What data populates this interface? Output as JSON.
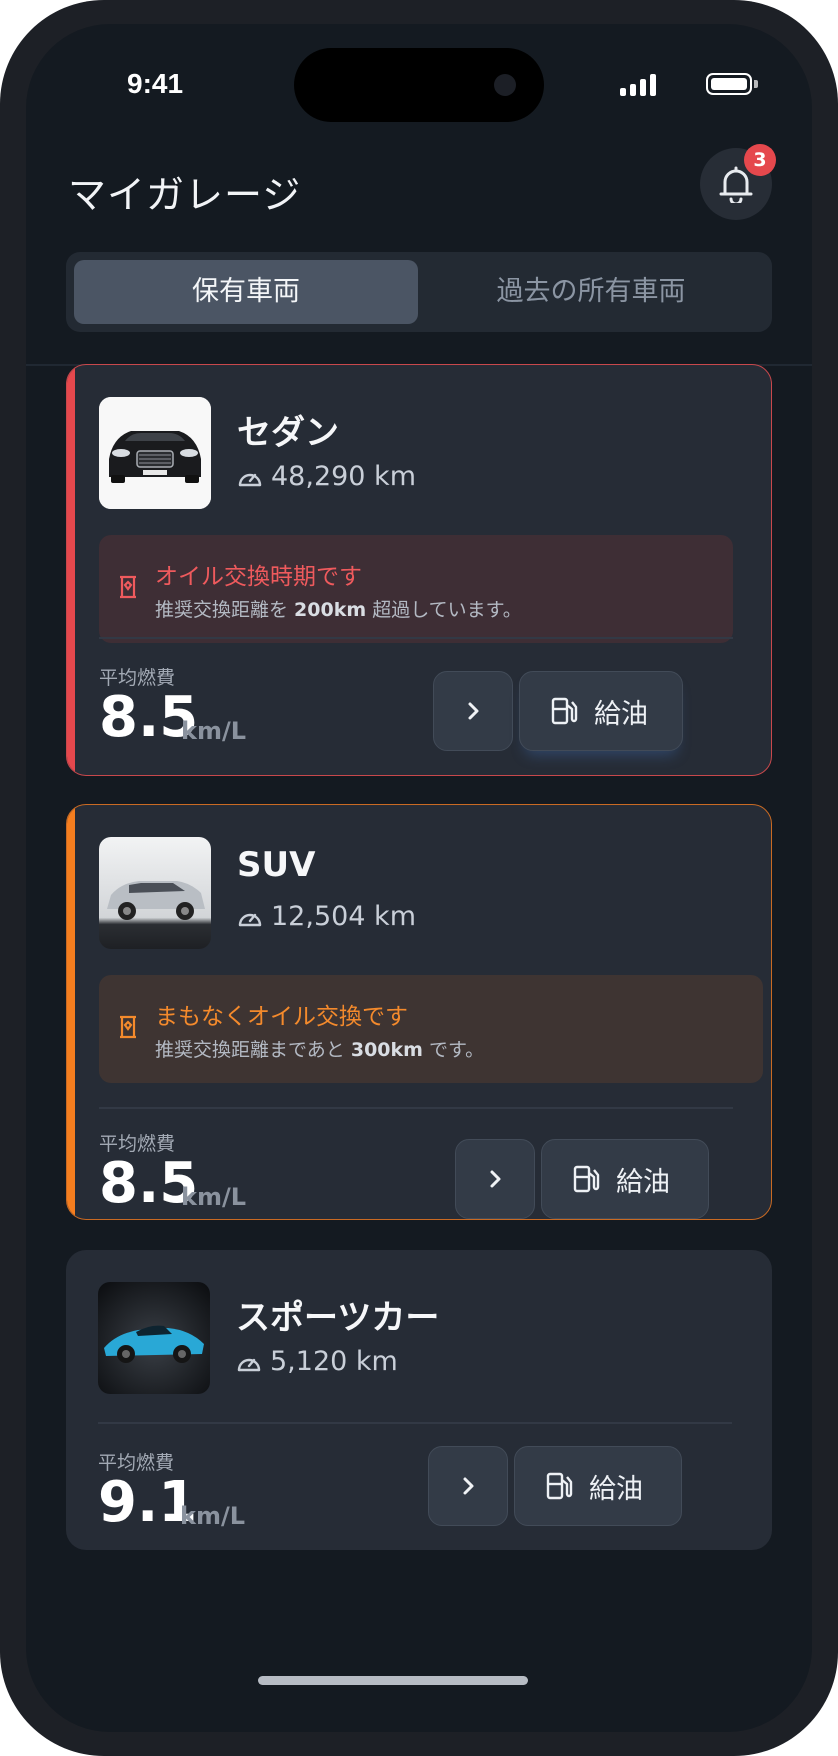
{
  "status": {
    "time": "9:41"
  },
  "header": {
    "title": "マイガレージ",
    "notification_count": "3"
  },
  "tabs": [
    {
      "label": "保有車両",
      "active": true
    },
    {
      "label": "過去の所有車両",
      "active": false
    }
  ],
  "vehicles": [
    {
      "name": "セダン",
      "mileage": "48,290 km",
      "alert": {
        "level": "danger",
        "title": "オイル交換時期です",
        "body_prefix": "推奨交換距離を ",
        "body_value": "200km",
        "body_suffix": " 超過しています。"
      },
      "efficiency_label": "平均燃費",
      "efficiency_value": "8.5",
      "efficiency_unit": "km/L",
      "refuel_label": "給油"
    },
    {
      "name": "SUV",
      "mileage": "12,504 km",
      "alert": {
        "level": "warning",
        "title": "まもなくオイル交換です",
        "body_prefix": "推奨交換距離まであと ",
        "body_value": "300km",
        "body_suffix": " です。"
      },
      "efficiency_label": "平均燃費",
      "efficiency_value": "8.5",
      "efficiency_unit": "km/L",
      "refuel_label": "給油"
    },
    {
      "name": "スポーツカー",
      "mileage": "5,120 km",
      "efficiency_label": "平均燃費",
      "efficiency_value": "9.1",
      "efficiency_unit": "km/L",
      "refuel_label": "給油"
    }
  ],
  "colors": {
    "danger": "#e5484d",
    "warning": "#f57e1f",
    "background": "#141a21",
    "card": "#262c36"
  },
  "icons": [
    "bell-icon",
    "speedometer-icon",
    "oil-icon",
    "chevron-right-icon",
    "fuel-pump-icon"
  ]
}
